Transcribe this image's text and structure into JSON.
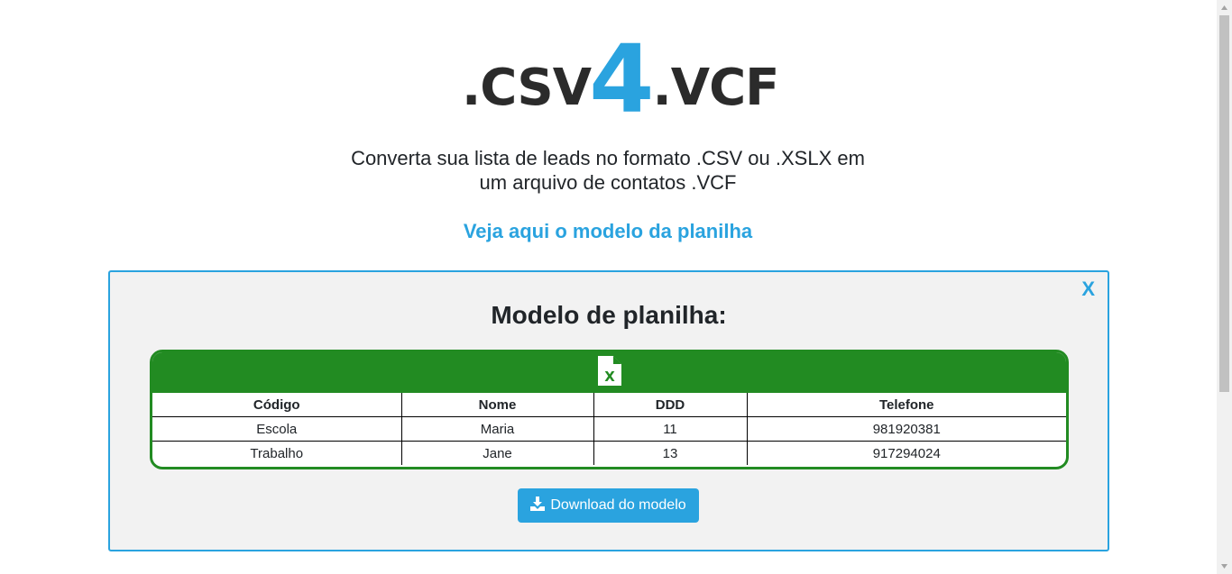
{
  "logo": {
    "left": ".CSV",
    "number": "4",
    "right": ".VCF"
  },
  "subtitle": {
    "line1": "Converta sua lista de leads no formato .CSV ou .XSLX em",
    "line2": "um arquivo de contatos .VCF"
  },
  "model_link": "Veja aqui o modelo da planilha",
  "panel": {
    "close": "X",
    "title": "Modelo de planilha:",
    "sheet_icon": "excel-file-icon",
    "table": {
      "headers": [
        "Código",
        "Nome",
        "DDD",
        "Telefone"
      ],
      "rows": [
        [
          "Escola",
          "Maria",
          "11",
          "981920381"
        ],
        [
          "Trabalho",
          "Jane",
          "13",
          "917294024"
        ]
      ]
    },
    "download": {
      "label": "Download do modelo",
      "icon": "download-icon"
    }
  },
  "colors": {
    "accent": "#2aa3df",
    "sheet_green": "#228b22"
  }
}
